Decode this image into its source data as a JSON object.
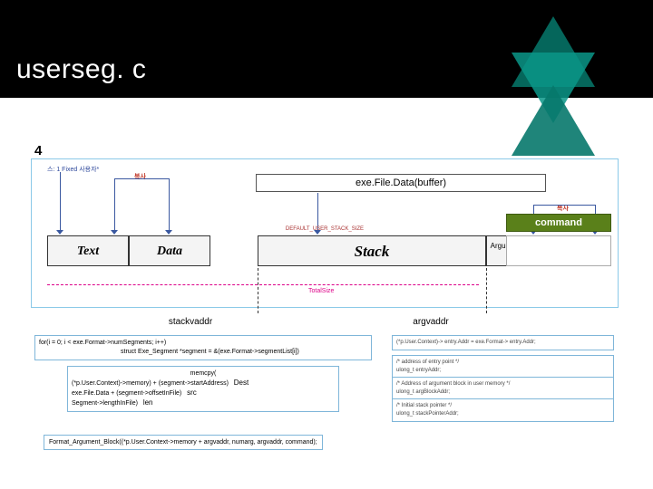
{
  "title": "userseg. c",
  "page_number": "4",
  "k1_label": "스: 1 Fixed 사용자*",
  "copy_label_a": "복사",
  "copy_label_b": "복사",
  "exe_file_box": "exe.File.Data(buffer)",
  "command_box": "command",
  "segments": {
    "stack_top_label": "DEFAULT_USER_STACK_SIZE",
    "text": "Text",
    "data": "Data",
    "stack": "Stack",
    "arg": "Argument"
  },
  "total_size": "TotalSize",
  "pointers": {
    "stackvaddr": "stackvaddr",
    "argvaddr": "argvaddr"
  },
  "code_left": {
    "for_line": "for(i = 0; i < exe.Format->numSegments; i++)",
    "segdecl": "struct Exe_Segment *segment = &(exe.Format->segmentList[i])",
    "memcpy": "memcpy(",
    "dest_line": "(*p.User.Context)->memory) + (segment->startAddress)",
    "dest_tag": "Dest",
    "src_line": "exe.File.Data + (segment->offsetInFile)",
    "src_tag": "src",
    "len_line": "Segment->lengthInFile)",
    "len_tag": "len"
  },
  "code_right": {
    "line1": "(*p.User.Context)-> entry.Addr = exe.Format-> entry.Addr;",
    "note2a": "/* address of entry point */",
    "note2b": "ulong_t entryAddr;",
    "note3a": "/* Address of argument block in user memory */",
    "note3b": "ulong_t argBlockAddr;",
    "note4a": "/* Initial stack pointer */",
    "note4b": "ulong_t stackPointerAddr;"
  },
  "format_call": "Format_Argument_Block((*p.User.Context->memory + argvaddr, numarg, argvaddr, command);"
}
